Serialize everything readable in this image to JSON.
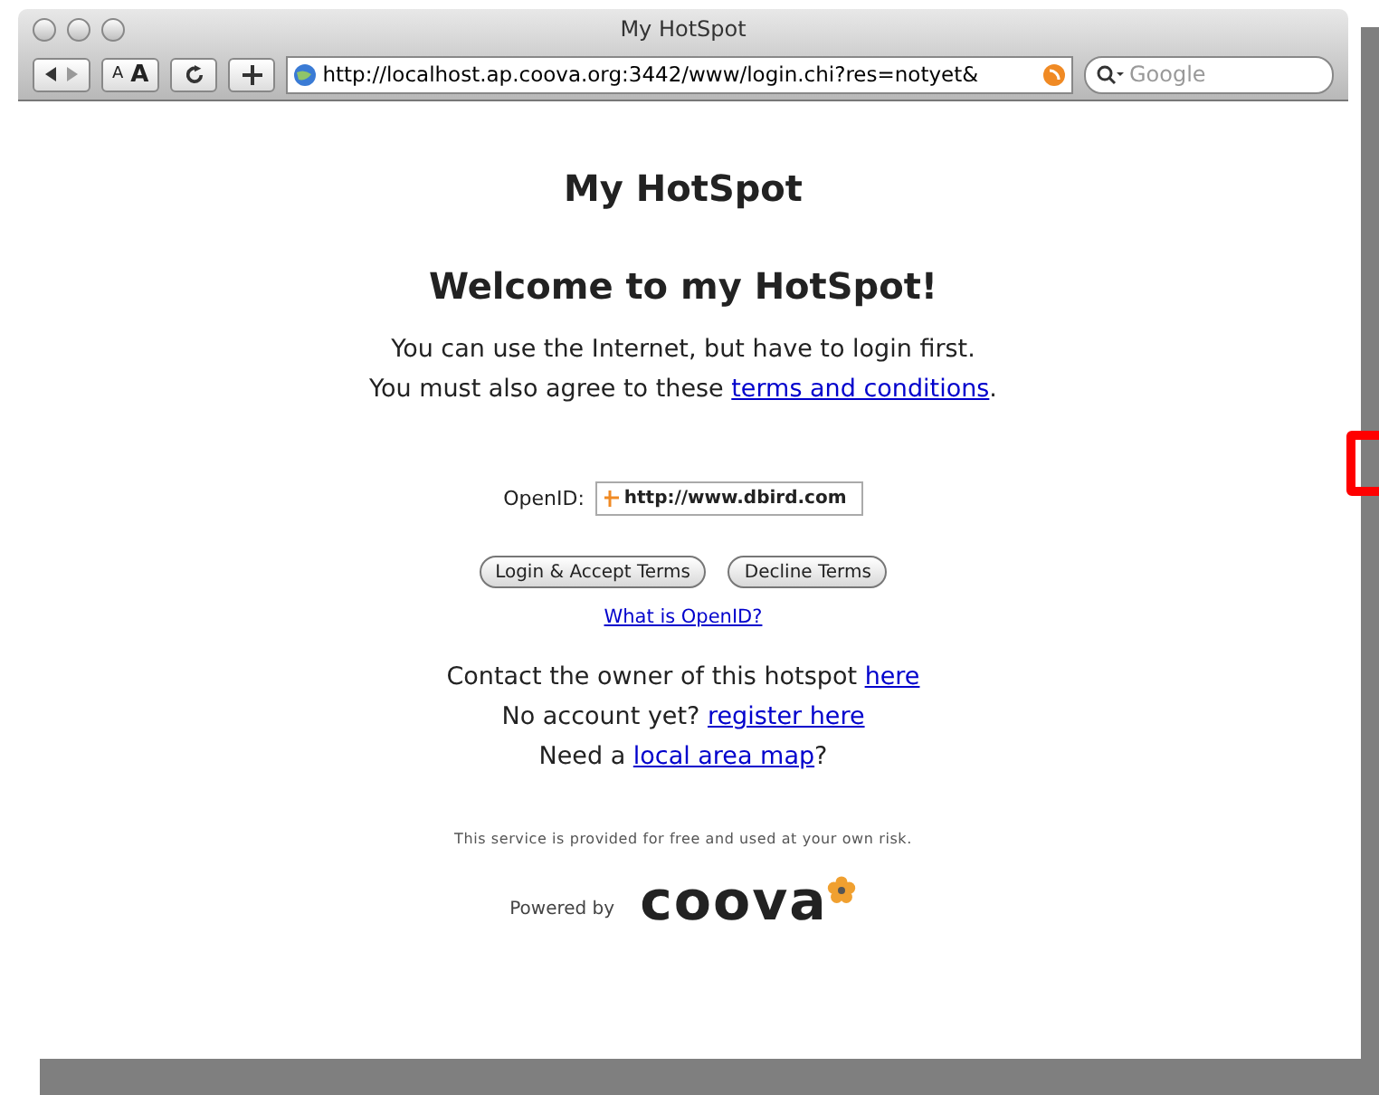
{
  "window": {
    "title": "My HotSpot"
  },
  "toolbar": {
    "url": "http://localhost.ap.coova.org:3442/www/login.chi?res=notyet&",
    "search": {
      "placeholder": "Google"
    },
    "text_small": "A",
    "text_large": "A"
  },
  "page": {
    "heading": "My HotSpot",
    "welcome": "Welcome to my HotSpot!",
    "intro": "You can use the Internet, but have to login first.",
    "terms_prefix": "You must also agree to these ",
    "terms_link": "terms and conditions",
    "terms_suffix": ".",
    "openid": {
      "label": "OpenID:",
      "value": "http://www.dbird.com"
    },
    "buttons": [
      "Login & Accept Terms",
      "Decline Terms"
    ],
    "openid_help": "What is OpenID?",
    "links": [
      {
        "prefix": "Contact the owner of this hotspot ",
        "link": "here"
      },
      {
        "prefix": "No account yet? ",
        "link": "register here"
      },
      {
        "prefix": "Need a ",
        "link": "local area map",
        "suffix": "?"
      }
    ],
    "disclaimer": "This service is provided for free and used at your own risk.",
    "powered_by": "Powered by",
    "logo": "coova"
  }
}
